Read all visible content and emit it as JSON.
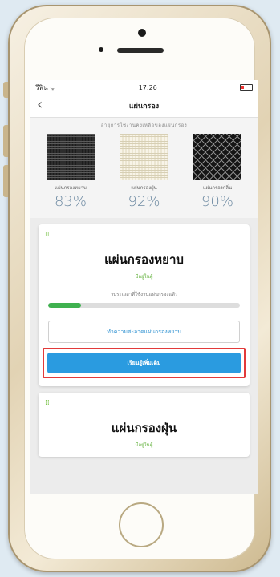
{
  "status_bar": {
    "carrier": "วีฟิน ᯤ",
    "time": "17:26"
  },
  "nav": {
    "back_icon": "chevron-left-icon",
    "title": "แผ่นกรอง"
  },
  "usage": {
    "caption": "อายุการใช้งานคงเหลือของแผ่นกรอง",
    "filters": [
      {
        "name": "แผ่นกรองหยาบ",
        "percent": "83%"
      },
      {
        "name": "แผ่นกรองฝุ่น",
        "percent": "92%"
      },
      {
        "name": "แผ่นกรองกลิ่น",
        "percent": "90%"
      }
    ]
  },
  "cards": [
    {
      "title": "แผ่นกรองหยาบ",
      "subtitle": "มีอยู่ในตู้",
      "progress_label": "วนระเวลาที่ใช้งานแผ่นกรองแล้ว",
      "progress": 0.17,
      "clean_button": "ทำความสะอาดแผ่นกรองหยาบ",
      "learn_button": "เรียนรู้เพิ่มเติม"
    },
    {
      "title": "แผ่นกรองฝุ่น",
      "subtitle": "มีอยู่ในตู้"
    }
  ],
  "colors": {
    "accent": "#2a9be0",
    "progress": "#3fb14f",
    "highlight": "#e23a3a"
  }
}
